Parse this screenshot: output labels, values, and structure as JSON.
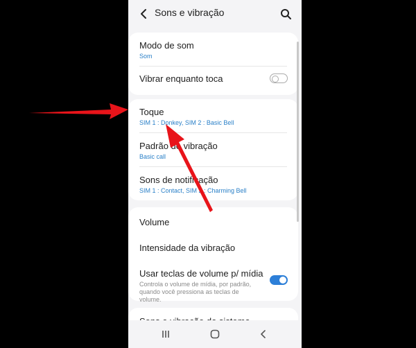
{
  "header": {
    "title": "Sons e vibração",
    "back_icon": "chevron-left-icon",
    "search_icon": "search-icon"
  },
  "group1": {
    "sound_mode": {
      "title": "Modo de som",
      "value": "Som"
    },
    "vibrate_while_ringing": {
      "title": "Vibrar enquanto toca",
      "enabled": false
    }
  },
  "group2": {
    "ringtone": {
      "title": "Toque",
      "value": "SIM 1 : Donkey, SIM 2 : Basic Bell"
    },
    "vibration_pattern": {
      "title": "Padrão de vibração",
      "value": "Basic call"
    },
    "notification_sounds": {
      "title": "Sons de notificação",
      "value": "SIM 1 : Contact, SIM 2 : Charming Bell"
    }
  },
  "group3": {
    "volume": {
      "title": "Volume"
    },
    "vibration_intensity": {
      "title": "Intensidade da vibração"
    },
    "volume_keys_media": {
      "title": "Usar teclas de volume p/ mídia",
      "description": "Controla o volume de mídia, por padrão, quando você pressiona as teclas de volume.",
      "enabled": true
    }
  },
  "group4": {
    "system_sound": {
      "title": "Sons e vibração do sistema"
    }
  },
  "navbar": {
    "recents_icon": "recents-icon",
    "home_icon": "home-icon",
    "back_icon": "back-chevron-icon"
  },
  "colors": {
    "accent": "#2d7fd8",
    "subtitle_blue": "#2a80c8",
    "arrow_red": "#e8141a",
    "background": "#f4f4f6"
  }
}
